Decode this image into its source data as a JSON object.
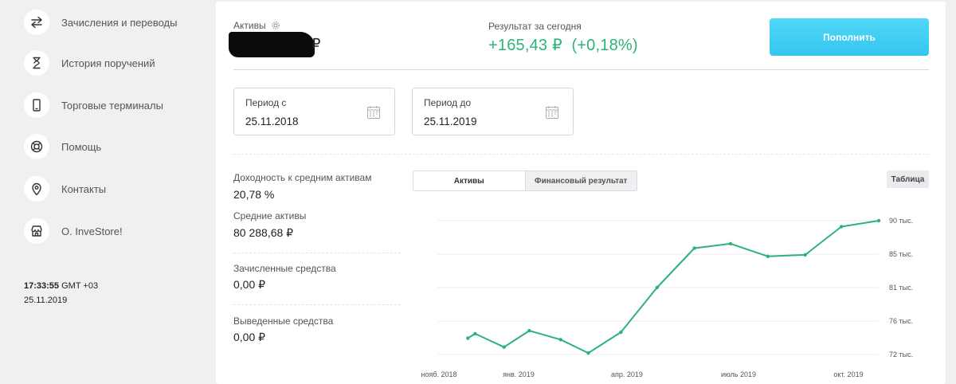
{
  "sidebar": {
    "items": [
      {
        "label": "Зачисления и переводы",
        "icon": "transfer-arrows-icon"
      },
      {
        "label": "История поручений",
        "icon": "hourglass-icon"
      },
      {
        "label": "Торговые терминалы",
        "icon": "phone-icon"
      },
      {
        "label": "Помощь",
        "icon": "lifebuoy-icon"
      },
      {
        "label": "Контакты",
        "icon": "location-pin-icon"
      },
      {
        "label": "О. InveStore!",
        "icon": "store-icon"
      }
    ],
    "time": "17:33:55",
    "timezone": "GMT +03",
    "date": "25.11.2019"
  },
  "header": {
    "assets_label": "Активы",
    "assets_currency": "₽",
    "today_label": "Результат за сегодня",
    "today_value": "+165,43 ₽  (+0,18%)",
    "today_color": "#2db37a",
    "topup_button": "Пополнить"
  },
  "period": {
    "from_label": "Период с",
    "from_value": "25.11.2018",
    "to_label": "Период до",
    "to_value": "25.11.2019"
  },
  "stats": [
    {
      "label": "Доходность к средним активам",
      "value": "20,78 %"
    },
    {
      "label": "Средние активы",
      "value": "80 288,68 ₽"
    },
    {
      "label": "Зачисленные средства",
      "value": "0,00 ₽"
    },
    {
      "label": "Выведенные средства",
      "value": "0,00 ₽"
    }
  ],
  "chart_controls": {
    "tab_assets": "Активы",
    "tab_financial": "Финансовый результат",
    "table_button": "Таблица"
  },
  "chart_data": {
    "type": "line",
    "color": "#2db37a",
    "x_tick_labels": [
      "нояб. 2018",
      "янв. 2019",
      "апр. 2019",
      "июль 2019",
      "окт. 2019"
    ],
    "y_tick_labels": [
      "90 тыс.",
      "85 тыс.",
      "81 тыс.",
      "76 тыс.",
      "72 тыс."
    ],
    "ylim": [
      72000,
      90000
    ],
    "grid": true,
    "series": [
      {
        "x": [
          "2018-11-25",
          "2018-12-01",
          "2018-12-25",
          "2019-01-15",
          "2019-02-10",
          "2019-03-05",
          "2019-04-01",
          "2019-05-01",
          "2019-06-01",
          "2019-07-01",
          "2019-08-01",
          "2019-09-01",
          "2019-10-01",
          "2019-11-01"
        ],
        "y": [
          74200,
          74800,
          73000,
          75200,
          74000,
          72200,
          75000,
          81000,
          86300,
          86900,
          85200,
          85400,
          89200,
          90000
        ]
      }
    ]
  }
}
